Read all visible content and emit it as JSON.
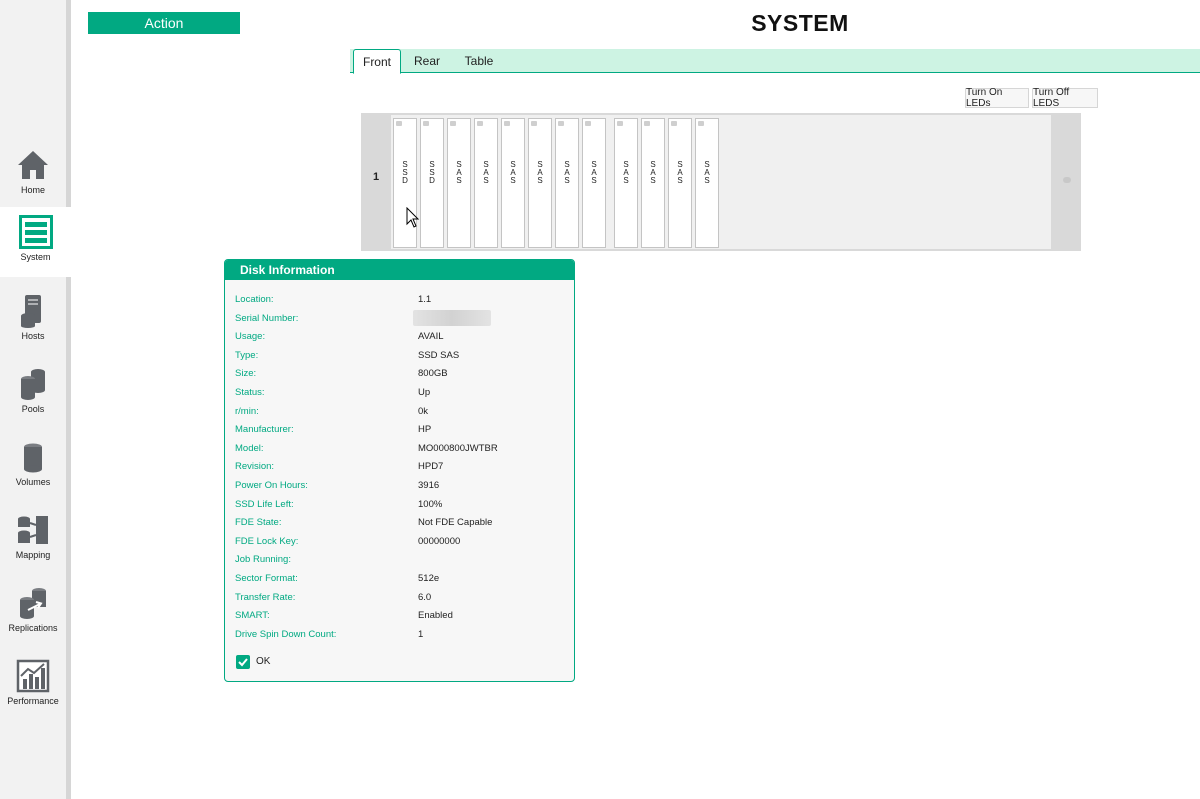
{
  "sidebar": {
    "items": [
      {
        "label": "Home",
        "icon": "home-icon"
      },
      {
        "label": "System",
        "icon": "system-icon",
        "active": true
      },
      {
        "label": "Hosts",
        "icon": "hosts-icon"
      },
      {
        "label": "Pools",
        "icon": "pools-icon"
      },
      {
        "label": "Volumes",
        "icon": "volumes-icon"
      },
      {
        "label": "Mapping",
        "icon": "mapping-icon"
      },
      {
        "label": "Replications",
        "icon": "replications-icon"
      },
      {
        "label": "Performance",
        "icon": "performance-icon"
      }
    ]
  },
  "header": {
    "action_label": "Action",
    "title": "SYSTEM"
  },
  "tabs": [
    {
      "label": "Front",
      "active": true
    },
    {
      "label": "Rear"
    },
    {
      "label": "Table"
    }
  ],
  "led_buttons": {
    "on_label": "Turn On LEDs",
    "off_label": "Turn Off LEDS"
  },
  "enclosure": {
    "number": "1",
    "slots": [
      "SSD",
      "SSD",
      "SAS",
      "SAS",
      "SAS",
      "SAS",
      "SAS",
      "SAS",
      "SAS",
      "SAS",
      "SAS",
      "SAS"
    ]
  },
  "disk_info": {
    "title": "Disk Information",
    "rows": [
      {
        "label": "Location:",
        "value": "1.1"
      },
      {
        "label": "Serial Number:",
        "value": ""
      },
      {
        "label": "Usage:",
        "value": "AVAIL"
      },
      {
        "label": "Type:",
        "value": "SSD SAS"
      },
      {
        "label": "Size:",
        "value": "800GB"
      },
      {
        "label": "Status:",
        "value": "Up"
      },
      {
        "label": "r/min:",
        "value": "0k"
      },
      {
        "label": "Manufacturer:",
        "value": "HP"
      },
      {
        "label": "Model:",
        "value": "MO000800JWTBR"
      },
      {
        "label": "Revision:",
        "value": "HPD7"
      },
      {
        "label": "Power On Hours:",
        "value": "3916"
      },
      {
        "label": "SSD Life Left:",
        "value": "100%"
      },
      {
        "label": "FDE State:",
        "value": "Not FDE Capable"
      },
      {
        "label": "FDE Lock Key:",
        "value": "00000000"
      },
      {
        "label": "Job Running:",
        "value": ""
      },
      {
        "label": "Sector Format:",
        "value": "512e"
      },
      {
        "label": "Transfer Rate:",
        "value": "6.0"
      },
      {
        "label": "SMART:",
        "value": "Enabled"
      },
      {
        "label": "Drive Spin Down Count:",
        "value": "1"
      }
    ],
    "ok_label": "OK"
  },
  "colors": {
    "accent": "#01a982",
    "tab_bar": "#cdf3e3",
    "icon_gray": "#5f6368"
  }
}
